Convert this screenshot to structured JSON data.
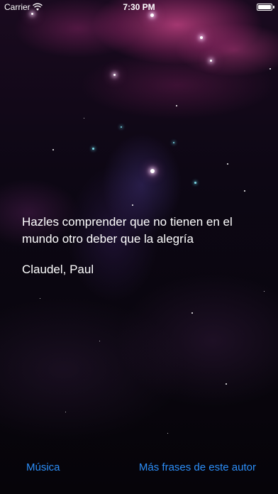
{
  "status_bar": {
    "carrier": "Carrier",
    "time": "7:30 PM"
  },
  "quote": {
    "text": "Hazles comprender que no tienen en el mundo otro deber que la alegría",
    "author": "Claudel, Paul"
  },
  "bottom_bar": {
    "music_label": "Música",
    "more_quotes_label": "Más frases de este autor"
  },
  "colors": {
    "link": "#2c8ef8",
    "text": "#ffffff"
  }
}
